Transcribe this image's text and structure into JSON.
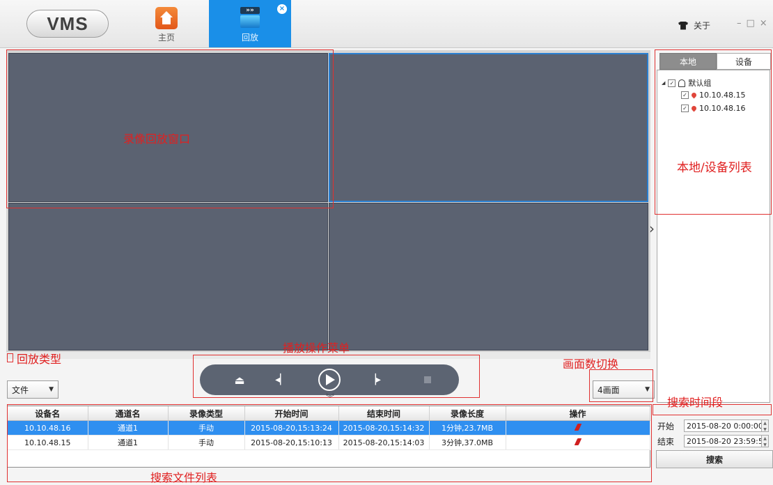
{
  "app": {
    "logo": "VMS",
    "tabs": [
      {
        "label": "主页",
        "icon": "home-icon"
      },
      {
        "label": "回放",
        "icon": "clapperboard-icon"
      }
    ],
    "about_label": "关于",
    "window_controls": [
      "–",
      "□",
      "×"
    ]
  },
  "right_panel": {
    "tabs": [
      "本地",
      "设备"
    ],
    "tree": {
      "group": "默认组",
      "devices": [
        "10.10.48.15",
        "10.10.48.16"
      ]
    }
  },
  "controls": {
    "playback_type": "文件",
    "pane_count": "4画面"
  },
  "table": {
    "headers": [
      "设备名",
      "通道名",
      "录像类型",
      "开始时间",
      "结束时间",
      "录像长度",
      "操作"
    ],
    "rows": [
      [
        "10.10.48.16",
        "通道1",
        "手动",
        "2015-08-20,15:13:24",
        "2015-08-20,15:14:32",
        "1分钟,23.7MB",
        "pin-icon"
      ],
      [
        "10.10.48.15",
        "通道1",
        "手动",
        "2015-08-20,15:10:13",
        "2015-08-20,15:14:03",
        "3分钟,37.0MB",
        "pin-icon"
      ]
    ],
    "selected_row": 0
  },
  "time": {
    "start_label": "开始",
    "start_value": "2015-08-20 0:00:00",
    "end_label": "结束",
    "end_value": "2015-08-20 23:59:59",
    "search_label": "搜索"
  },
  "annotations": {
    "playback_window": "录像回放窗口",
    "device_list": "本地/设备列表",
    "playback_type": "回放类型",
    "control_menu": "播放操作菜单",
    "pane_switch": "画面数切换",
    "time_range": "搜索时间段",
    "file_list": "搜索文件列表"
  },
  "colors": {
    "accent": "#1a8fe8",
    "pane": "#5b6271",
    "annotation": "#e02020",
    "selection": "#2f8ff0"
  }
}
